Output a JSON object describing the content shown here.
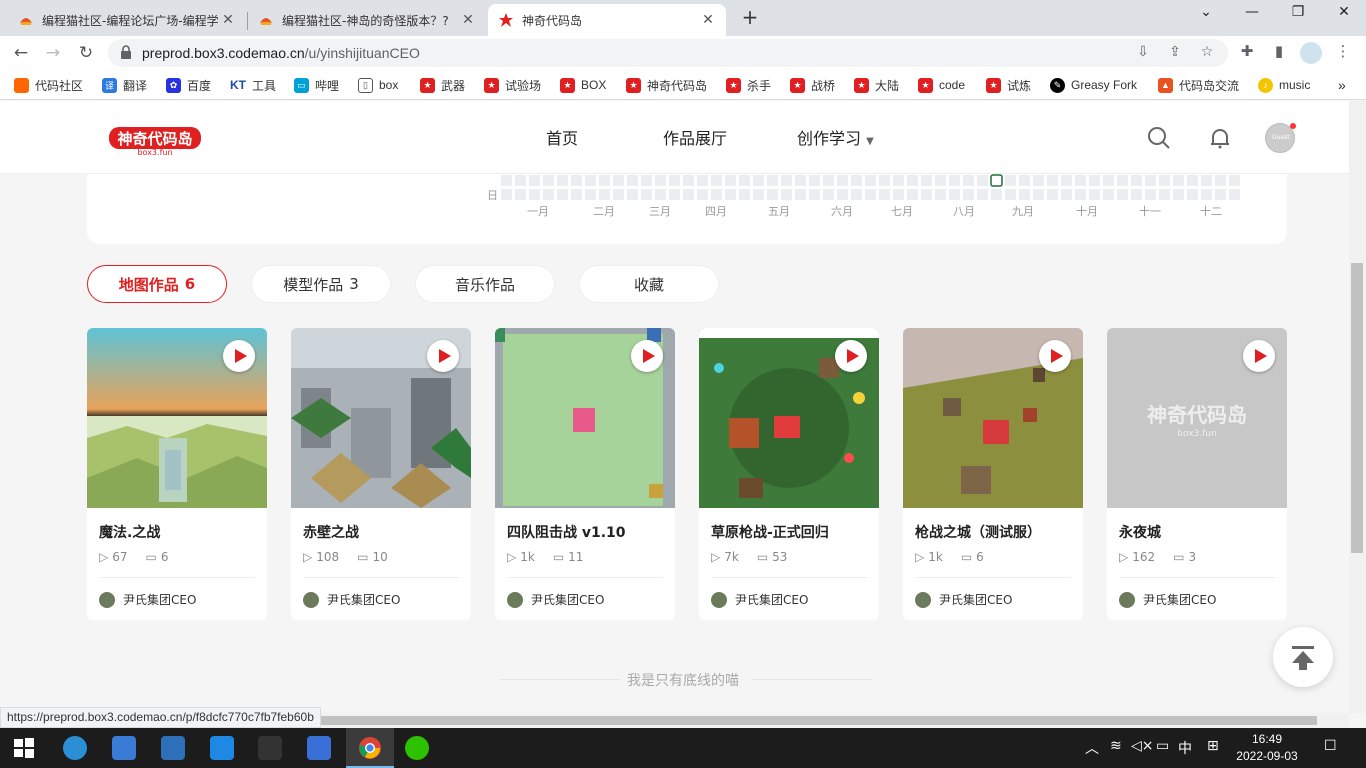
{
  "browser": {
    "tabs": [
      {
        "title": "编程猫社区-编程论坛广场-编程学",
        "close": "✕"
      },
      {
        "title": "编程猫社区-神岛的奇怪版本？?",
        "close": "✕"
      },
      {
        "title": "神奇代码岛",
        "close": "✕"
      }
    ],
    "new_tab": "+",
    "url_host": "preprod.box3.codemao.cn",
    "url_path": "/u/yinshijituanCEO",
    "bookmarks": [
      {
        "label": "代码社区",
        "color": "#f60"
      },
      {
        "label": "翻译",
        "color": "#2a7ae2"
      },
      {
        "label": "百度",
        "color": "#2932e1"
      },
      {
        "label": "工具",
        "color": "#1e4da0"
      },
      {
        "label": "哔哩",
        "color": "#00a1d6"
      },
      {
        "label": "box",
        "color": "#555"
      },
      {
        "label": "武器",
        "color": "#e02020"
      },
      {
        "label": "试验场",
        "color": "#e02020"
      },
      {
        "label": "BOX",
        "color": "#e02020"
      },
      {
        "label": "神奇代码岛",
        "color": "#e02020"
      },
      {
        "label": "杀手",
        "color": "#e02020"
      },
      {
        "label": "战桥",
        "color": "#e02020"
      },
      {
        "label": "大陆",
        "color": "#e02020"
      },
      {
        "label": "code",
        "color": "#e02020"
      },
      {
        "label": "试炼",
        "color": "#e02020"
      },
      {
        "label": "Greasy Fork",
        "color": "#000"
      },
      {
        "label": "代码岛交流",
        "color": "#e02020"
      },
      {
        "label": "music",
        "color": "#f5c400"
      }
    ],
    "bm_kt_prefix": "KT",
    "status_url": "https://preprod.box3.codemao.cn/p/f8dcfc770c7fb7feb60b"
  },
  "site": {
    "logo_text": "神奇代码岛",
    "logo_sub": "box3.fun",
    "nav": [
      "首页",
      "作品展厅",
      "创作学习"
    ],
    "avatar_text": "Guest"
  },
  "activity": {
    "day_label": "日",
    "months": [
      "一月",
      "二月",
      "三月",
      "四月",
      "五月",
      "六月",
      "七月",
      "八月",
      "九月",
      "十月",
      "十一",
      "十二"
    ]
  },
  "profile_tabs": [
    {
      "label": "地图作品",
      "count": "6"
    },
    {
      "label": "模型作品",
      "count": "3"
    },
    {
      "label": "音乐作品",
      "count": ""
    },
    {
      "label": "收藏",
      "count": ""
    }
  ],
  "works": [
    {
      "title": "魔法.之战",
      "plays": "67",
      "comments": "6",
      "author": "尹氏集团CEO"
    },
    {
      "title": "赤壁之战",
      "plays": "108",
      "comments": "10",
      "author": "尹氏集团CEO"
    },
    {
      "title": "四队阻击战 v1.10",
      "plays": "1k",
      "comments": "11",
      "author": "尹氏集团CEO"
    },
    {
      "title": "草原枪战-正式回归",
      "plays": "7k",
      "comments": "53",
      "author": "尹氏集团CEO"
    },
    {
      "title": "枪战之城（测试服）",
      "plays": "1k",
      "comments": "6",
      "author": "尹氏集团CEO"
    },
    {
      "title": "永夜城",
      "plays": "162",
      "comments": "3",
      "author": "尹氏集团CEO"
    }
  ],
  "placeholder_logo": "神奇代码岛",
  "placeholder_sub": "box3.fun",
  "footer": "我是只有底线的喵",
  "taskbar": {
    "ime": "中",
    "time": "16:49",
    "date": "2022-09-03"
  }
}
